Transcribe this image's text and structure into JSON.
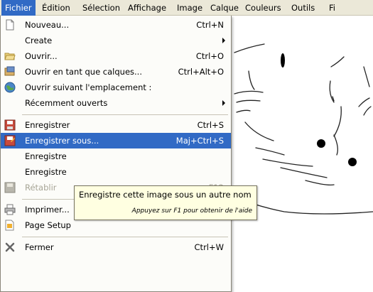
{
  "menubar": {
    "items": [
      {
        "label": "Fichier",
        "active": true
      },
      {
        "label": "Édition"
      },
      {
        "label": "Sélection"
      },
      {
        "label": "Affichage"
      },
      {
        "label": "Image"
      },
      {
        "label": "Calque"
      },
      {
        "label": "Couleurs"
      },
      {
        "label": "Outils"
      },
      {
        "label": "Fi"
      }
    ]
  },
  "file_menu": {
    "items": [
      {
        "label": "Nouveau...",
        "shortcut": "Ctrl+N",
        "icon": "new-document-icon"
      },
      {
        "label": "Create",
        "shortcut": "",
        "submenu": true
      },
      {
        "label": "Ouvrir...",
        "shortcut": "Ctrl+O",
        "icon": "open-folder-icon"
      },
      {
        "label": "Ouvrir en tant que calques...",
        "shortcut": "Ctrl+Alt+O",
        "icon": "open-as-layers-icon"
      },
      {
        "label": "Ouvrir suivant l'emplacement :",
        "shortcut": "",
        "icon": "globe-icon"
      },
      {
        "label": "Récemment ouverts",
        "shortcut": "",
        "submenu": true
      },
      {
        "label": "Enregistrer",
        "shortcut": "Ctrl+S",
        "icon": "save-icon"
      },
      {
        "label": "Enregistrer sous...",
        "shortcut": "Maj+Ctrl+S",
        "icon": "save-as-icon",
        "highlighted": true
      },
      {
        "label": "Enregistre",
        "shortcut": ""
      },
      {
        "label": "Enregistre",
        "shortcut": ""
      },
      {
        "label": "Rétablir",
        "shortcut": "F12",
        "icon": "revert-icon",
        "disabled": true
      },
      {
        "label": "Imprimer...",
        "shortcut": "",
        "icon": "printer-icon"
      },
      {
        "label": "Page Setup",
        "shortcut": "",
        "icon": "page-setup-icon"
      },
      {
        "label": "Fermer",
        "shortcut": "Ctrl+W",
        "icon": "close-icon"
      }
    ]
  },
  "tooltip": {
    "text": "Enregistre cette image sous un autre nom",
    "help": "Appuyez sur F1 pour obtenir de l'aide"
  },
  "colors": {
    "highlight": "#316ac5",
    "menubar_bg": "#ebe8d8",
    "tooltip_bg": "#ffffe1"
  }
}
